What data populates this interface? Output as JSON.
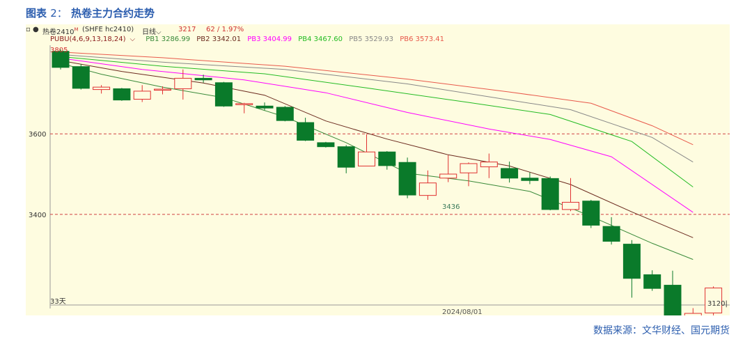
{
  "figure": {
    "prefix": "图表",
    "number": "2：",
    "title": "热卷主力合约走势",
    "source": "数据来源：文华财经、国元期货"
  },
  "toolbar": {
    "marker": "▫ ●",
    "contract": "热卷2410",
    "sup": "M",
    "code": "(SHFE hc2410)",
    "period": "日线",
    "price": "3217",
    "change": "62 / 1.97%"
  },
  "legend": {
    "indicator": "PUBU(4,6,9,13,18,24)",
    "items": [
      {
        "label": "PB1 3286.99",
        "color": "#3a8a3a"
      },
      {
        "label": "PB2 3342.01",
        "color": "#6b2a1e"
      },
      {
        "label": "PB3 3404.99",
        "color": "#ff00ff"
      },
      {
        "label": "PB4 3467.60",
        "color": "#22bb22"
      },
      {
        "label": "PB5 3529.93",
        "color": "#888888"
      },
      {
        "label": "PB6 3573.41",
        "color": "#e8584a"
      }
    ]
  },
  "chart_data": {
    "type": "candlestick",
    "title": "热卷主力合约走势",
    "up_color": "#e03030",
    "down_color": "#0a7a2a",
    "ylim": [
      3180,
      3820
    ],
    "y_ticks": [
      3600,
      3400
    ],
    "x_label": "2024/08/01",
    "bars_label": "33天",
    "max_label": "3805",
    "min_label": "3120",
    "local_low_label": "3436",
    "candles": [
      {
        "o": 3805,
        "h": 3810,
        "l": 3760,
        "c": 3765
      },
      {
        "o": 3767,
        "h": 3773,
        "l": 3710,
        "c": 3713
      },
      {
        "o": 3710,
        "h": 3721,
        "l": 3700,
        "c": 3716
      },
      {
        "o": 3712,
        "h": 3714,
        "l": 3682,
        "c": 3684
      },
      {
        "o": 3686,
        "h": 3721,
        "l": 3679,
        "c": 3706
      },
      {
        "o": 3709,
        "h": 3718,
        "l": 3698,
        "c": 3711
      },
      {
        "o": 3712,
        "h": 3760,
        "l": 3685,
        "c": 3738
      },
      {
        "o": 3738,
        "h": 3747,
        "l": 3727,
        "c": 3734
      },
      {
        "o": 3727,
        "h": 3729,
        "l": 3667,
        "c": 3669
      },
      {
        "o": 3675,
        "h": 3677,
        "l": 3651,
        "c": 3675
      },
      {
        "o": 3669,
        "h": 3678,
        "l": 3659,
        "c": 3664
      },
      {
        "o": 3666,
        "h": 3669,
        "l": 3631,
        "c": 3633
      },
      {
        "o": 3628,
        "h": 3640,
        "l": 3582,
        "c": 3584
      },
      {
        "o": 3578,
        "h": 3580,
        "l": 3566,
        "c": 3568
      },
      {
        "o": 3568,
        "h": 3572,
        "l": 3502,
        "c": 3517
      },
      {
        "o": 3520,
        "h": 3599,
        "l": 3520,
        "c": 3555
      },
      {
        "o": 3555,
        "h": 3557,
        "l": 3511,
        "c": 3521
      },
      {
        "o": 3529,
        "h": 3541,
        "l": 3440,
        "c": 3448
      },
      {
        "o": 3447,
        "h": 3509,
        "l": 3436,
        "c": 3478
      },
      {
        "o": 3490,
        "h": 3547,
        "l": 3480,
        "c": 3500
      },
      {
        "o": 3503,
        "h": 3529,
        "l": 3470,
        "c": 3526
      },
      {
        "o": 3518,
        "h": 3551,
        "l": 3490,
        "c": 3530
      },
      {
        "o": 3514,
        "h": 3531,
        "l": 3479,
        "c": 3490
      },
      {
        "o": 3490,
        "h": 3504,
        "l": 3475,
        "c": 3484
      },
      {
        "o": 3489,
        "h": 3494,
        "l": 3410,
        "c": 3412
      },
      {
        "o": 3412,
        "h": 3490,
        "l": 3408,
        "c": 3430
      },
      {
        "o": 3433,
        "h": 3436,
        "l": 3366,
        "c": 3373
      },
      {
        "o": 3370,
        "h": 3393,
        "l": 3325,
        "c": 3333
      },
      {
        "o": 3326,
        "h": 3336,
        "l": 3193,
        "c": 3241
      },
      {
        "o": 3250,
        "h": 3261,
        "l": 3210,
        "c": 3216
      },
      {
        "o": 3224,
        "h": 3260,
        "l": 3148,
        "c": 3148
      },
      {
        "o": 3128,
        "h": 3167,
        "l": 3120,
        "c": 3154
      },
      {
        "o": 3155,
        "h": 3221,
        "l": 3147,
        "c": 3217
      }
    ],
    "series": [
      {
        "name": "PB1",
        "color": "#3a8a3a",
        "points": [
          [
            1,
            3775
          ],
          [
            3,
            3748
          ],
          [
            6,
            3716
          ],
          [
            9,
            3690
          ],
          [
            12,
            3642
          ],
          [
            15,
            3578
          ],
          [
            18,
            3502
          ],
          [
            21,
            3483
          ],
          [
            24,
            3457
          ],
          [
            27,
            3395
          ],
          [
            30,
            3328
          ],
          [
            32,
            3288
          ]
        ]
      },
      {
        "name": "PB2",
        "color": "#6b2a1e",
        "points": [
          [
            1,
            3782
          ],
          [
            4,
            3755
          ],
          [
            8,
            3726
          ],
          [
            11,
            3696
          ],
          [
            14,
            3632
          ],
          [
            17,
            3587
          ],
          [
            20,
            3548
          ],
          [
            23,
            3520
          ],
          [
            26,
            3474
          ],
          [
            29,
            3406
          ],
          [
            32,
            3342
          ]
        ]
      },
      {
        "name": "PB3",
        "color": "#ff00ff",
        "points": [
          [
            1,
            3788
          ],
          [
            5,
            3760
          ],
          [
            10,
            3734
          ],
          [
            14,
            3702
          ],
          [
            18,
            3653
          ],
          [
            22,
            3612
          ],
          [
            25,
            3586
          ],
          [
            28,
            3543
          ],
          [
            32,
            3405
          ]
        ]
      },
      {
        "name": "PB4",
        "color": "#22bb22",
        "points": [
          [
            1,
            3792
          ],
          [
            6,
            3768
          ],
          [
            11,
            3749
          ],
          [
            16,
            3714
          ],
          [
            21,
            3678
          ],
          [
            25,
            3648
          ],
          [
            29,
            3581
          ],
          [
            32,
            3468
          ]
        ]
      },
      {
        "name": "PB5",
        "color": "#888888",
        "points": [
          [
            1,
            3797
          ],
          [
            6,
            3778
          ],
          [
            12,
            3760
          ],
          [
            18,
            3724
          ],
          [
            22,
            3692
          ],
          [
            26,
            3660
          ],
          [
            30,
            3591
          ],
          [
            32,
            3530
          ]
        ]
      },
      {
        "name": "PB6",
        "color": "#e8584a",
        "points": [
          [
            1,
            3803
          ],
          [
            6,
            3789
          ],
          [
            12,
            3768
          ],
          [
            18,
            3736
          ],
          [
            23,
            3704
          ],
          [
            27,
            3676
          ],
          [
            30,
            3620
          ],
          [
            32,
            3573
          ]
        ]
      }
    ]
  }
}
